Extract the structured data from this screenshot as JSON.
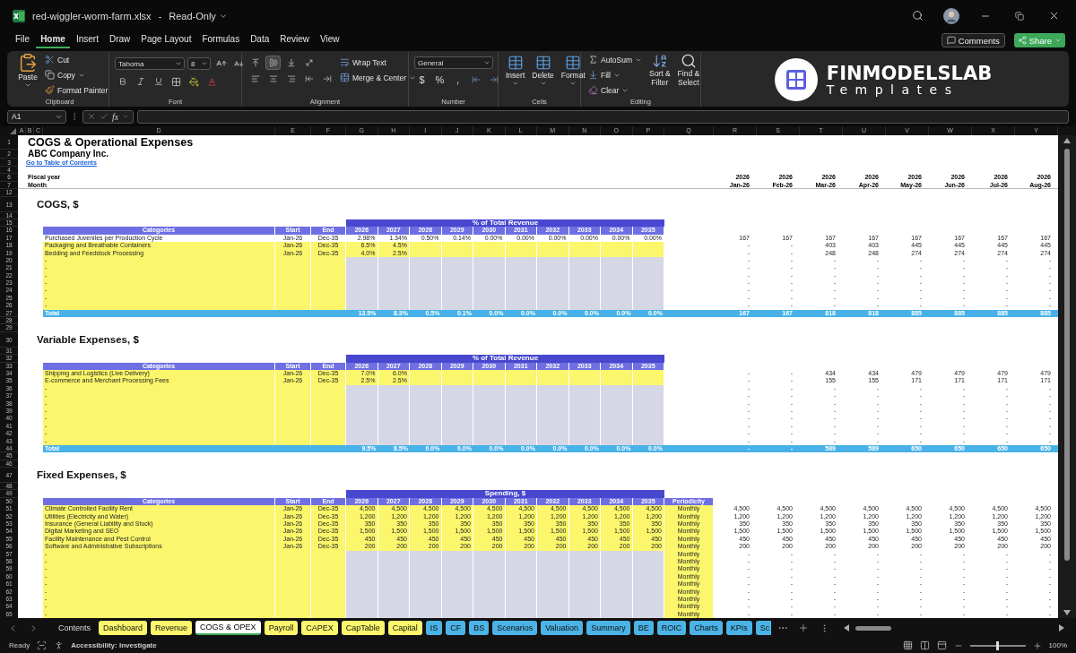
{
  "title_bar": {
    "file_name": "red-wiggler-worm-farm.xlsx",
    "separator": "-",
    "status": "Read-Only"
  },
  "menu": [
    {
      "label": "File",
      "selected": false
    },
    {
      "label": "Home",
      "selected": true
    },
    {
      "label": "Insert",
      "selected": false
    },
    {
      "label": "Draw",
      "selected": false
    },
    {
      "label": "Page Layout",
      "selected": false
    },
    {
      "label": "Formulas",
      "selected": false
    },
    {
      "label": "Data",
      "selected": false
    },
    {
      "label": "Review",
      "selected": false
    },
    {
      "label": "View",
      "selected": false
    }
  ],
  "actions": {
    "comments": "Comments",
    "share": "Share"
  },
  "ribbon": {
    "clipboard": {
      "label": "Clipboard",
      "paste": "Paste",
      "cut": "Cut",
      "copy": "Copy",
      "format_painter": "Format Painter"
    },
    "font": {
      "label": "Font",
      "font_name": "Tahoma",
      "font_size": "8"
    },
    "alignment": {
      "label": "Alignment",
      "wrap_text": "Wrap Text",
      "merge": "Merge & Center"
    },
    "number": {
      "label": "Number",
      "format": "General",
      "symbols": [
        "$",
        "%",
        ","
      ]
    },
    "cells": {
      "label": "Cells",
      "buttons": [
        "Insert",
        "Delete",
        "Format"
      ]
    },
    "editing": {
      "label": "Editing",
      "autosum": "AutoSum",
      "fill": "Fill",
      "clear": "Clear",
      "sort": [
        "Sort &",
        "Filter"
      ],
      "find": [
        "Find &",
        "Select"
      ]
    },
    "logo": {
      "name": "FINMODELSLAB",
      "tagline": "Templates"
    }
  },
  "formula_bar": {
    "name_box": "A1",
    "function_label": "fx"
  },
  "column_letters": [
    "A",
    "B",
    "C",
    "D",
    "E",
    "F",
    "G",
    "H",
    "I",
    "J",
    "K",
    "L",
    "M",
    "N",
    "O",
    "P",
    "Q",
    "R",
    "S",
    "T",
    "U",
    "V",
    "W",
    "X",
    "Y"
  ],
  "sheet_rows": [
    {
      "row_number": "1",
      "kind": "title",
      "text": "COGS & Operational Expenses"
    },
    {
      "row_number": "2",
      "kind": "subtitle",
      "text": "ABC Company Inc."
    },
    {
      "row_number": "3",
      "kind": "link",
      "text": "Go to Table of Contents"
    },
    {
      "row_number": "4",
      "kind": "blank"
    },
    {
      "row_number": "6",
      "kind": "label",
      "text": "Fiscal year",
      "cells": [
        "2026",
        "2026",
        "2026",
        "2026",
        "2026",
        "2026",
        "2026",
        "2026"
      ],
      "underlined": false
    },
    {
      "row_number": "7",
      "kind": "label",
      "text": "Month",
      "cells": [
        "Jan-26",
        "Feb-26",
        "Mar-26",
        "Apr-26",
        "May-26",
        "Jun-26",
        "Jul-26",
        "Aug-26"
      ],
      "underlined": true
    },
    {
      "row_number": "12",
      "kind": "blank"
    },
    {
      "row_number": "13",
      "kind": "heading",
      "text": "COGS, $"
    },
    {
      "row_number": "14",
      "kind": "blank"
    },
    {
      "row_number": "15",
      "kind": "band",
      "text": "% of Total Revenue"
    },
    {
      "row_number": "16",
      "kind": "columns",
      "headers": [
        "Categories",
        "Start",
        "End",
        "2026",
        "2027",
        "2028",
        "2029",
        "2030",
        "2031",
        "2032",
        "2033",
        "2034",
        "2035"
      ]
    },
    {
      "row_number": "17",
      "kind": "entry",
      "category": "Purchased Juveniles per Production Cycle",
      "start": "Jan-26",
      "end": "Dec-35",
      "values": [
        "2.98%",
        "1.34%",
        "0.50%",
        "0.14%",
        "0.00%",
        "0.00%",
        "0.00%",
        "0.00%",
        "0.00%",
        "0.00%"
      ],
      "monthly": [
        "167",
        "167",
        "167",
        "167",
        "167",
        "167",
        "167",
        "167"
      ]
    },
    {
      "row_number": "18",
      "kind": "input",
      "category": "Packaging and Breathable Containers",
      "start": "Jan-26",
      "end": "Dec-35",
      "values": [
        "6.5%",
        "4.5%"
      ],
      "monthly": [
        "-",
        "-",
        "403",
        "403",
        "445",
        "445",
        "445",
        "445"
      ]
    },
    {
      "row_number": "19",
      "kind": "input",
      "category": "Bedding and Feedstock Processing",
      "start": "Jan-26",
      "end": "Dec-35",
      "values": [
        "4.0%",
        "2.5%"
      ],
      "monthly": [
        "-",
        "-",
        "248",
        "248",
        "274",
        "274",
        "274",
        "274"
      ]
    },
    {
      "row_number": "20",
      "kind": "placeholder",
      "category": "-",
      "monthly": [
        "-",
        "-",
        "-",
        "-",
        "-",
        "-",
        "-",
        "-"
      ]
    },
    {
      "row_number": "21",
      "kind": "placeholder",
      "category": "-",
      "monthly": [
        "-",
        "-",
        "-",
        "-",
        "-",
        "-",
        "-",
        "-"
      ]
    },
    {
      "row_number": "22",
      "kind": "placeholder",
      "category": "-",
      "monthly": [
        "-",
        "-",
        "-",
        "-",
        "-",
        "-",
        "-",
        "-"
      ]
    },
    {
      "row_number": "23",
      "kind": "placeholder",
      "category": "-",
      "monthly": [
        "-",
        "-",
        "-",
        "-",
        "-",
        "-",
        "-",
        "-"
      ]
    },
    {
      "row_number": "24",
      "kind": "placeholder",
      "category": "-",
      "monthly": [
        "-",
        "-",
        "-",
        "-",
        "-",
        "-",
        "-",
        "-"
      ]
    },
    {
      "row_number": "25",
      "kind": "placeholder",
      "category": "-",
      "monthly": [
        "-",
        "-",
        "-",
        "-",
        "-",
        "-",
        "-",
        "-"
      ]
    },
    {
      "row_number": "26",
      "kind": "placeholder",
      "category": "-",
      "monthly": [
        "-",
        "-",
        "-",
        "-",
        "-",
        "-",
        "-",
        "-"
      ]
    },
    {
      "row_number": "27",
      "kind": "total",
      "label": "Total",
      "values": [
        "13.5%",
        "8.3%",
        "0.5%",
        "0.1%",
        "0.0%",
        "0.0%",
        "0.0%",
        "0.0%",
        "0.0%",
        "0.0%"
      ],
      "monthly": [
        "167",
        "167",
        "818",
        "818",
        "885",
        "885",
        "885",
        "885"
      ]
    },
    {
      "row_number": "28",
      "kind": "blank"
    },
    {
      "row_number": "29",
      "kind": "blank"
    },
    {
      "row_number": "30",
      "kind": "heading",
      "text": "Variable Expenses, $"
    },
    {
      "row_number": "31",
      "kind": "blank"
    },
    {
      "row_number": "32",
      "kind": "band",
      "text": "% of Total Revenue"
    },
    {
      "row_number": "33",
      "kind": "columns",
      "headers": [
        "Categories",
        "Start",
        "End",
        "2026",
        "2027",
        "2028",
        "2029",
        "2030",
        "2031",
        "2032",
        "2033",
        "2034",
        "2035"
      ]
    },
    {
      "row_number": "34",
      "kind": "input",
      "category": "Shipping and Logistics (Live Delivery)",
      "start": "Jan-26",
      "end": "Dec-35",
      "values": [
        "7.0%",
        "6.0%"
      ],
      "monthly": [
        "-",
        "-",
        "434",
        "434",
        "479",
        "479",
        "479",
        "479"
      ]
    },
    {
      "row_number": "35",
      "kind": "input",
      "category": "E-commerce and Merchant Processing Fees",
      "start": "Jan-26",
      "end": "Dec-35",
      "values": [
        "2.5%",
        "2.5%"
      ],
      "monthly": [
        "-",
        "-",
        "155",
        "155",
        "171",
        "171",
        "171",
        "171"
      ]
    },
    {
      "row_number": "36",
      "kind": "placeholder",
      "category": "-",
      "monthly": [
        "-",
        "-",
        "-",
        "-",
        "-",
        "-",
        "-",
        "-"
      ]
    },
    {
      "row_number": "37",
      "kind": "placeholder",
      "category": "-",
      "monthly": [
        "-",
        "-",
        "-",
        "-",
        "-",
        "-",
        "-",
        "-"
      ]
    },
    {
      "row_number": "38",
      "kind": "placeholder",
      "category": "-",
      "monthly": [
        "-",
        "-",
        "-",
        "-",
        "-",
        "-",
        "-",
        "-"
      ]
    },
    {
      "row_number": "39",
      "kind": "placeholder",
      "category": "-",
      "monthly": [
        "-",
        "-",
        "-",
        "-",
        "-",
        "-",
        "-",
        "-"
      ]
    },
    {
      "row_number": "40",
      "kind": "placeholder",
      "category": "-",
      "monthly": [
        "-",
        "-",
        "-",
        "-",
        "-",
        "-",
        "-",
        "-"
      ]
    },
    {
      "row_number": "41",
      "kind": "placeholder",
      "category": "-",
      "monthly": [
        "-",
        "-",
        "-",
        "-",
        "-",
        "-",
        "-",
        "-"
      ]
    },
    {
      "row_number": "42",
      "kind": "placeholder",
      "category": "-",
      "monthly": [
        "-",
        "-",
        "-",
        "-",
        "-",
        "-",
        "-",
        "-"
      ]
    },
    {
      "row_number": "43",
      "kind": "placeholder",
      "category": "-",
      "monthly": [
        "-",
        "-",
        "-",
        "-",
        "-",
        "-",
        "-",
        "-"
      ]
    },
    {
      "row_number": "44",
      "kind": "total",
      "label": "Total",
      "values": [
        "9.5%",
        "8.5%",
        "0.0%",
        "0.0%",
        "0.0%",
        "0.0%",
        "0.0%",
        "0.0%",
        "0.0%",
        "0.0%"
      ],
      "monthly": [
        "-",
        "-",
        "589",
        "589",
        "650",
        "650",
        "650",
        "650"
      ]
    },
    {
      "row_number": "45",
      "kind": "blank"
    },
    {
      "row_number": "46",
      "kind": "blank"
    },
    {
      "row_number": "47",
      "kind": "heading",
      "text": "Fixed Expenses, $"
    },
    {
      "row_number": "48",
      "kind": "blank"
    },
    {
      "row_number": "49",
      "kind": "band",
      "text": "Spending, $"
    },
    {
      "row_number": "50",
      "kind": "columns",
      "headers": [
        "Categories",
        "Start",
        "End",
        "2026",
        "2027",
        "2028",
        "2029",
        "2030",
        "2031",
        "2032",
        "2033",
        "2034",
        "2035",
        "Periodicity"
      ]
    },
    {
      "row_number": "51",
      "kind": "input",
      "category": "Climate Controlled Facility Rent",
      "start": "Jan-26",
      "end": "Dec-35",
      "values": [
        "4,500",
        "4,500",
        "4,500",
        "4,500",
        "4,500",
        "4,500",
        "4,500",
        "4,500",
        "4,500",
        "4,500"
      ],
      "periodicity": "Monthly",
      "monthly": [
        "4,500",
        "4,500",
        "4,500",
        "4,500",
        "4,500",
        "4,500",
        "4,500",
        "4,500"
      ]
    },
    {
      "row_number": "52",
      "kind": "input",
      "category": "Utilities (Electricity and Water)",
      "start": "Jan-26",
      "end": "Dec-35",
      "values": [
        "1,200",
        "1,200",
        "1,200",
        "1,200",
        "1,200",
        "1,200",
        "1,200",
        "1,200",
        "1,200",
        "1,200"
      ],
      "periodicity": "Monthly",
      "monthly": [
        "1,200",
        "1,200",
        "1,200",
        "1,200",
        "1,200",
        "1,200",
        "1,200",
        "1,200"
      ]
    },
    {
      "row_number": "53",
      "kind": "input",
      "category": "Insurance (General Liability and Stock)",
      "start": "Jan-26",
      "end": "Dec-35",
      "values": [
        "350",
        "350",
        "350",
        "350",
        "350",
        "350",
        "350",
        "350",
        "350",
        "350"
      ],
      "periodicity": "Monthly",
      "monthly": [
        "350",
        "350",
        "350",
        "350",
        "350",
        "350",
        "350",
        "350"
      ]
    },
    {
      "row_number": "54",
      "kind": "input",
      "category": "Digital Marketing and SEO",
      "start": "Jan-26",
      "end": "Dec-35",
      "values": [
        "1,500",
        "1,500",
        "1,500",
        "1,500",
        "1,500",
        "1,500",
        "1,500",
        "1,500",
        "1,500",
        "1,500"
      ],
      "periodicity": "Monthly",
      "monthly": [
        "1,500",
        "1,500",
        "1,500",
        "1,500",
        "1,500",
        "1,500",
        "1,500",
        "1,500"
      ]
    },
    {
      "row_number": "55",
      "kind": "input",
      "category": "Facility Maintenance and Pest Control",
      "start": "Jan-26",
      "end": "Dec-35",
      "values": [
        "450",
        "450",
        "450",
        "450",
        "450",
        "450",
        "450",
        "450",
        "450",
        "450"
      ],
      "periodicity": "Monthly",
      "monthly": [
        "450",
        "450",
        "450",
        "450",
        "450",
        "450",
        "450",
        "450"
      ]
    },
    {
      "row_number": "56",
      "kind": "input",
      "category": "Software and Administrative Subscriptions",
      "start": "Jan-26",
      "end": "Dec-35",
      "values": [
        "200",
        "200",
        "200",
        "200",
        "200",
        "200",
        "200",
        "200",
        "200",
        "200"
      ],
      "periodicity": "Monthly",
      "monthly": [
        "200",
        "200",
        "200",
        "200",
        "200",
        "200",
        "200",
        "200"
      ]
    },
    {
      "row_number": "57",
      "kind": "placeholder",
      "category": "-",
      "periodicity": "Monthly",
      "monthly": [
        "-",
        "-",
        "-",
        "-",
        "-",
        "-",
        "-",
        "-"
      ]
    },
    {
      "row_number": "58",
      "kind": "placeholder",
      "category": "-",
      "periodicity": "Monthly",
      "monthly": [
        "-",
        "-",
        "-",
        "-",
        "-",
        "-",
        "-",
        "-"
      ]
    },
    {
      "row_number": "59",
      "kind": "placeholder",
      "category": "-",
      "periodicity": "Monthly",
      "monthly": [
        "-",
        "-",
        "-",
        "-",
        "-",
        "-",
        "-",
        "-"
      ]
    },
    {
      "row_number": "60",
      "kind": "placeholder",
      "category": "-",
      "periodicity": "Monthly",
      "monthly": [
        "-",
        "-",
        "-",
        "-",
        "-",
        "-",
        "-",
        "-"
      ]
    },
    {
      "row_number": "61",
      "kind": "placeholder",
      "category": "-",
      "periodicity": "Monthly",
      "monthly": [
        "-",
        "-",
        "-",
        "-",
        "-",
        "-",
        "-",
        "-"
      ]
    },
    {
      "row_number": "62",
      "kind": "placeholder",
      "category": "-",
      "periodicity": "Monthly",
      "monthly": [
        "-",
        "-",
        "-",
        "-",
        "-",
        "-",
        "-",
        "-"
      ]
    },
    {
      "row_number": "63",
      "kind": "placeholder",
      "category": "-",
      "periodicity": "Monthly",
      "monthly": [
        "-",
        "-",
        "-",
        "-",
        "-",
        "-",
        "-",
        "-"
      ]
    },
    {
      "row_number": "64",
      "kind": "placeholder",
      "category": "-",
      "periodicity": "Monthly",
      "monthly": [
        "-",
        "-",
        "-",
        "-",
        "-",
        "-",
        "-",
        "-"
      ]
    },
    {
      "row_number": "65",
      "kind": "placeholder",
      "category": "-",
      "periodicity": "Monthly",
      "monthly": [
        "-",
        "-",
        "-",
        "-",
        "-",
        "-",
        "-",
        "-"
      ]
    }
  ],
  "sheet_tabs": [
    {
      "label": "Contents",
      "selected": false
    },
    {
      "label": "Dashboard",
      "selected": false,
      "color": "#fbf66b"
    },
    {
      "label": "Revenue",
      "selected": false,
      "color": "#fbf66b"
    },
    {
      "label": "COGS & OPEX",
      "selected": true
    },
    {
      "label": "Payroll",
      "selected": false,
      "color": "#fbf66b"
    },
    {
      "label": "CAPEX",
      "selected": false,
      "color": "#fbf66b"
    },
    {
      "label": "CapTable",
      "selected": false,
      "color": "#fbf66b"
    },
    {
      "label": "Capital",
      "selected": false,
      "color": "#fbf66b"
    },
    {
      "label": "IS",
      "selected": false,
      "color": "#4bb3e6"
    },
    {
      "label": "CF",
      "selected": false,
      "color": "#4bb3e6"
    },
    {
      "label": "BS",
      "selected": false,
      "color": "#4bb3e6"
    },
    {
      "label": "Scenarios",
      "selected": false,
      "color": "#4bb3e6"
    },
    {
      "label": "Valuation",
      "selected": false,
      "color": "#4bb3e6"
    },
    {
      "label": "Summary",
      "selected": false,
      "color": "#4bb3e6"
    },
    {
      "label": "BE",
      "selected": false,
      "color": "#4bb3e6"
    },
    {
      "label": "ROIC",
      "selected": false,
      "color": "#4bb3e6"
    },
    {
      "label": "Charts",
      "selected": false,
      "color": "#4bb3e6"
    },
    {
      "label": "KPIs",
      "selected": false,
      "color": "#4bb3e6"
    },
    {
      "label": "Sc",
      "selected": false,
      "color": "#4bb3e6"
    }
  ],
  "status_bar": {
    "mode": "Ready",
    "accessibility": "Accessibility: Investigate",
    "zoom_slider": {
      "level": 0.5
    },
    "zoom": "100%"
  }
}
